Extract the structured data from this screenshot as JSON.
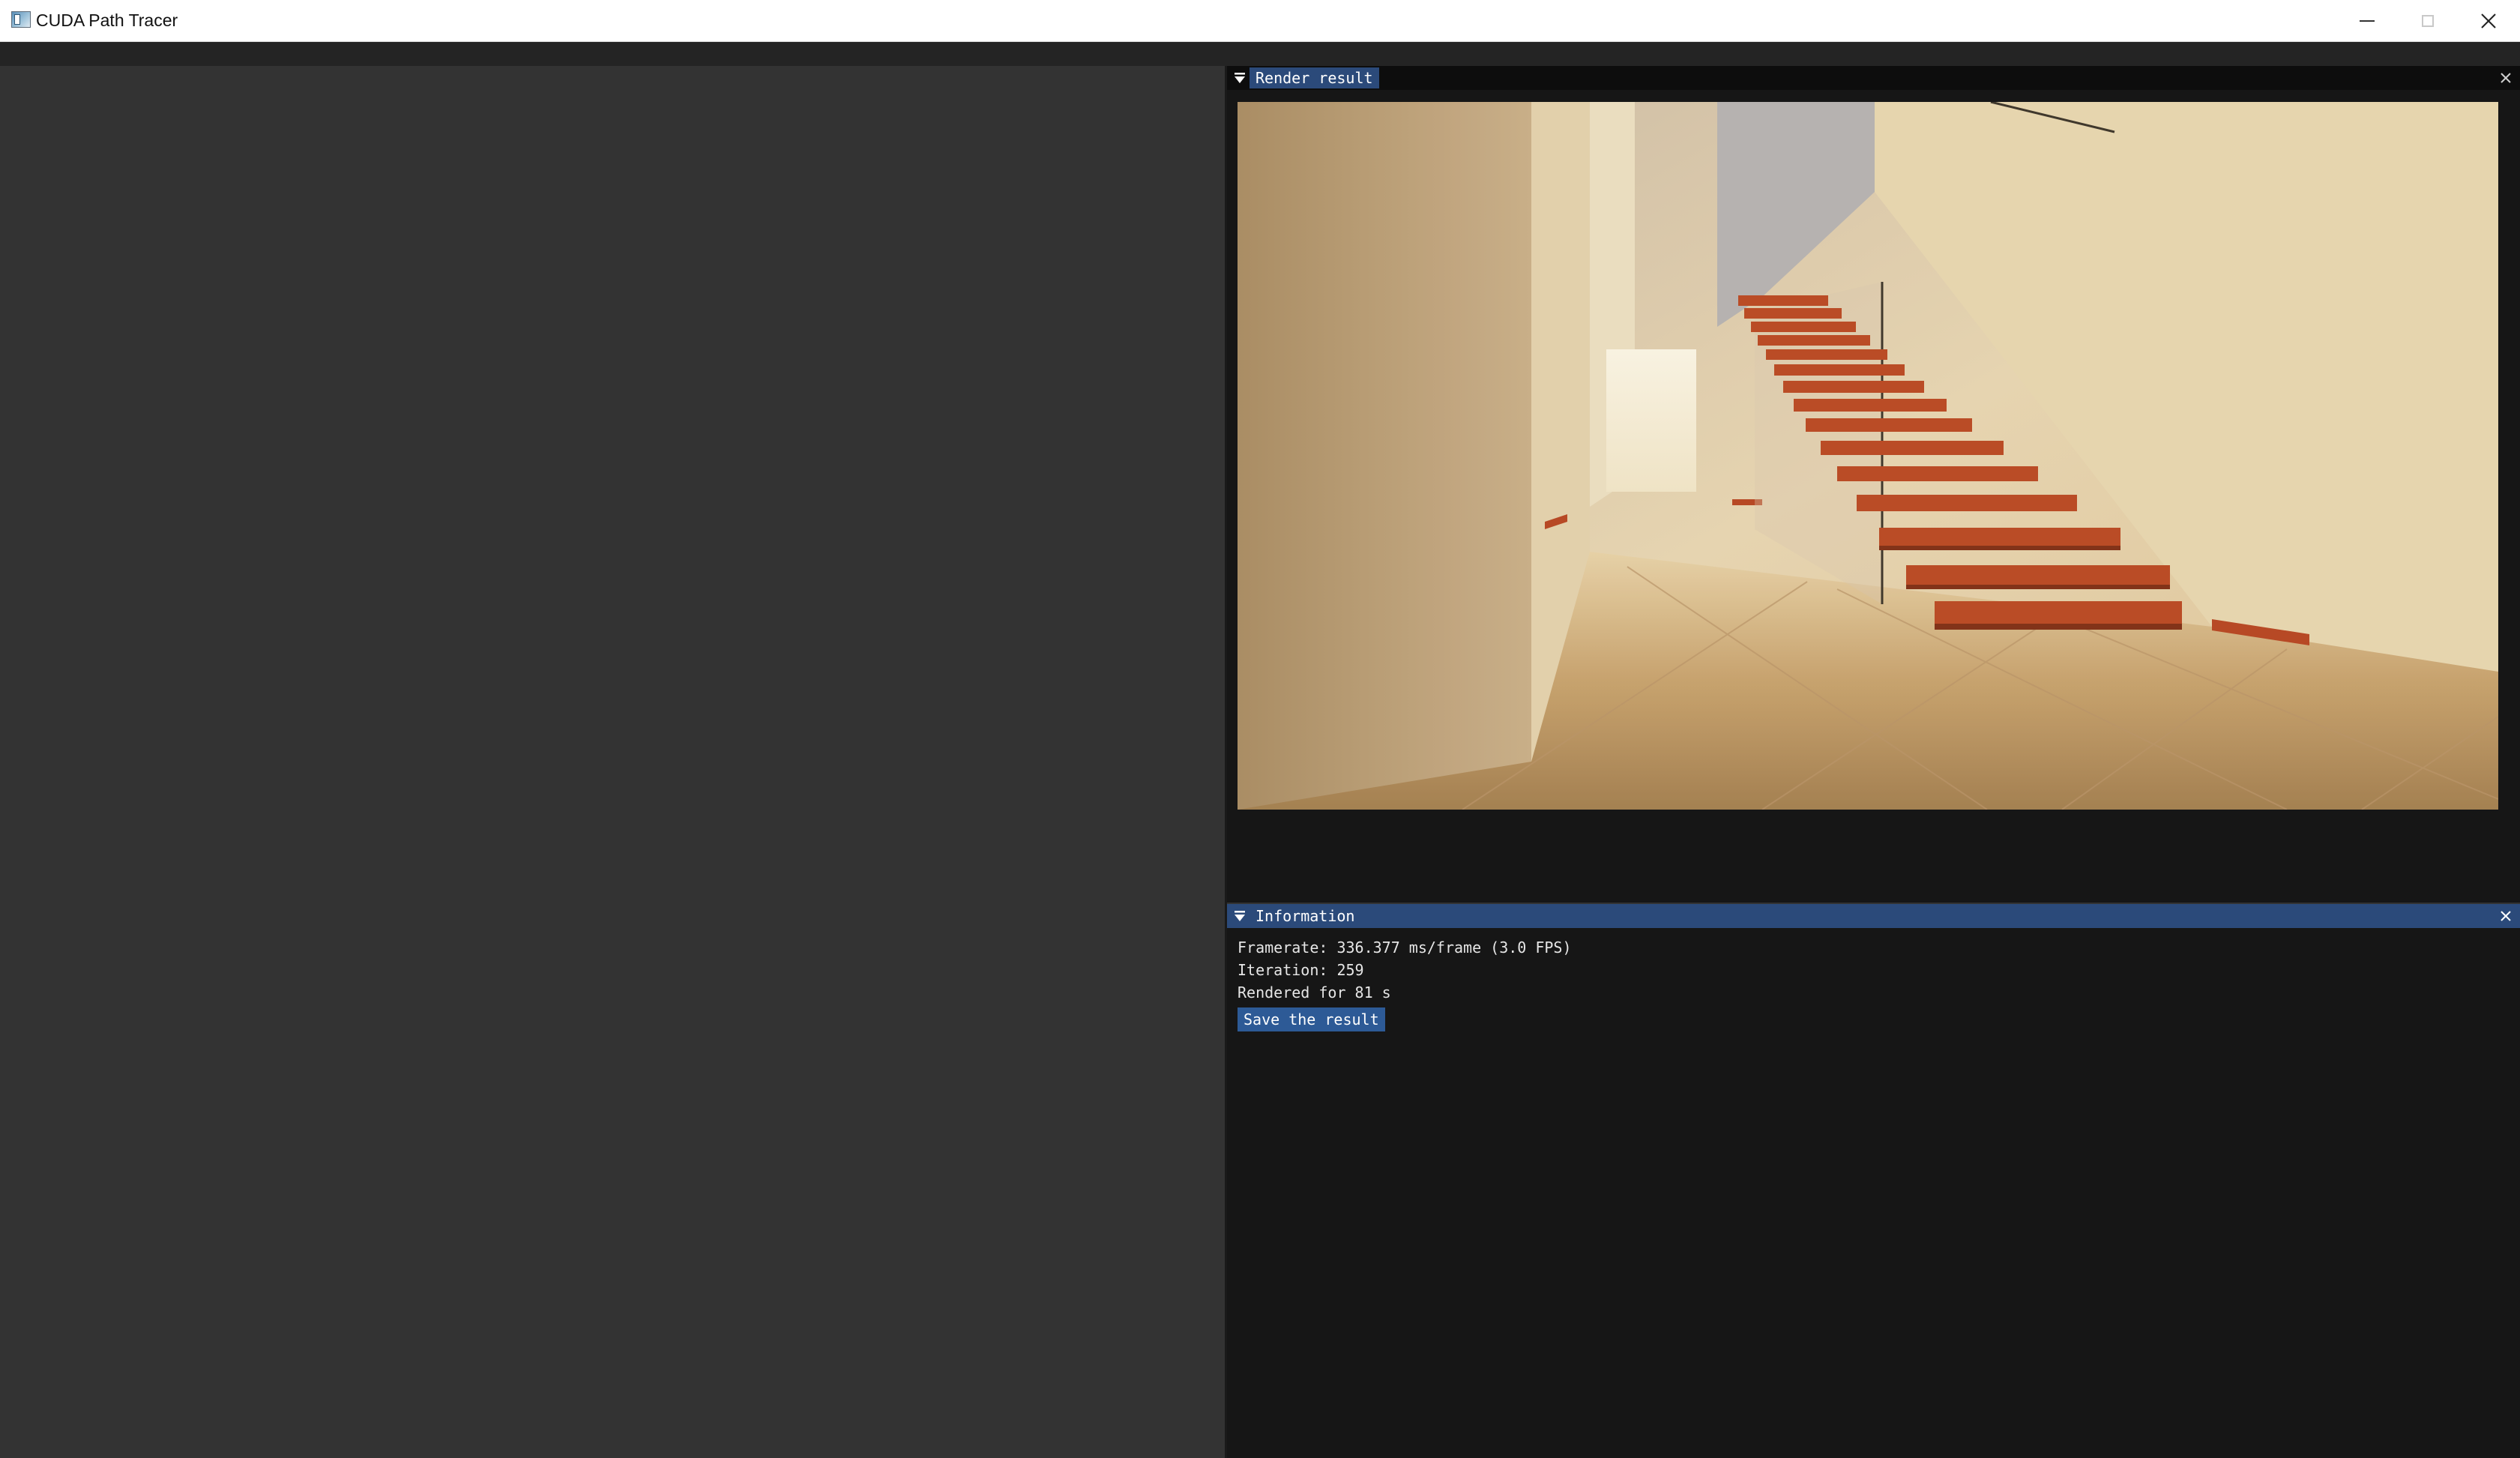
{
  "window": {
    "title": "CUDA Path Tracer",
    "icon": "app-window-icon",
    "controls": [
      "minimize-icon",
      "maximize-icon",
      "close-icon"
    ]
  },
  "panels": {
    "render": {
      "title": "Render result",
      "image_description_icon": "render-image"
    },
    "information": {
      "title": "Information",
      "framerate": "Framerate: 336.377 ms/frame (3.0 FPS)",
      "iteration": "Iteration: 259",
      "rendered_for": "Rendered for 81 s",
      "save_button_label": "Save the result"
    }
  },
  "colors": {
    "accent": "#2b4a7a",
    "button": "#2d5a96",
    "panel_bg": "#161616",
    "workspace_bg": "#333333"
  }
}
